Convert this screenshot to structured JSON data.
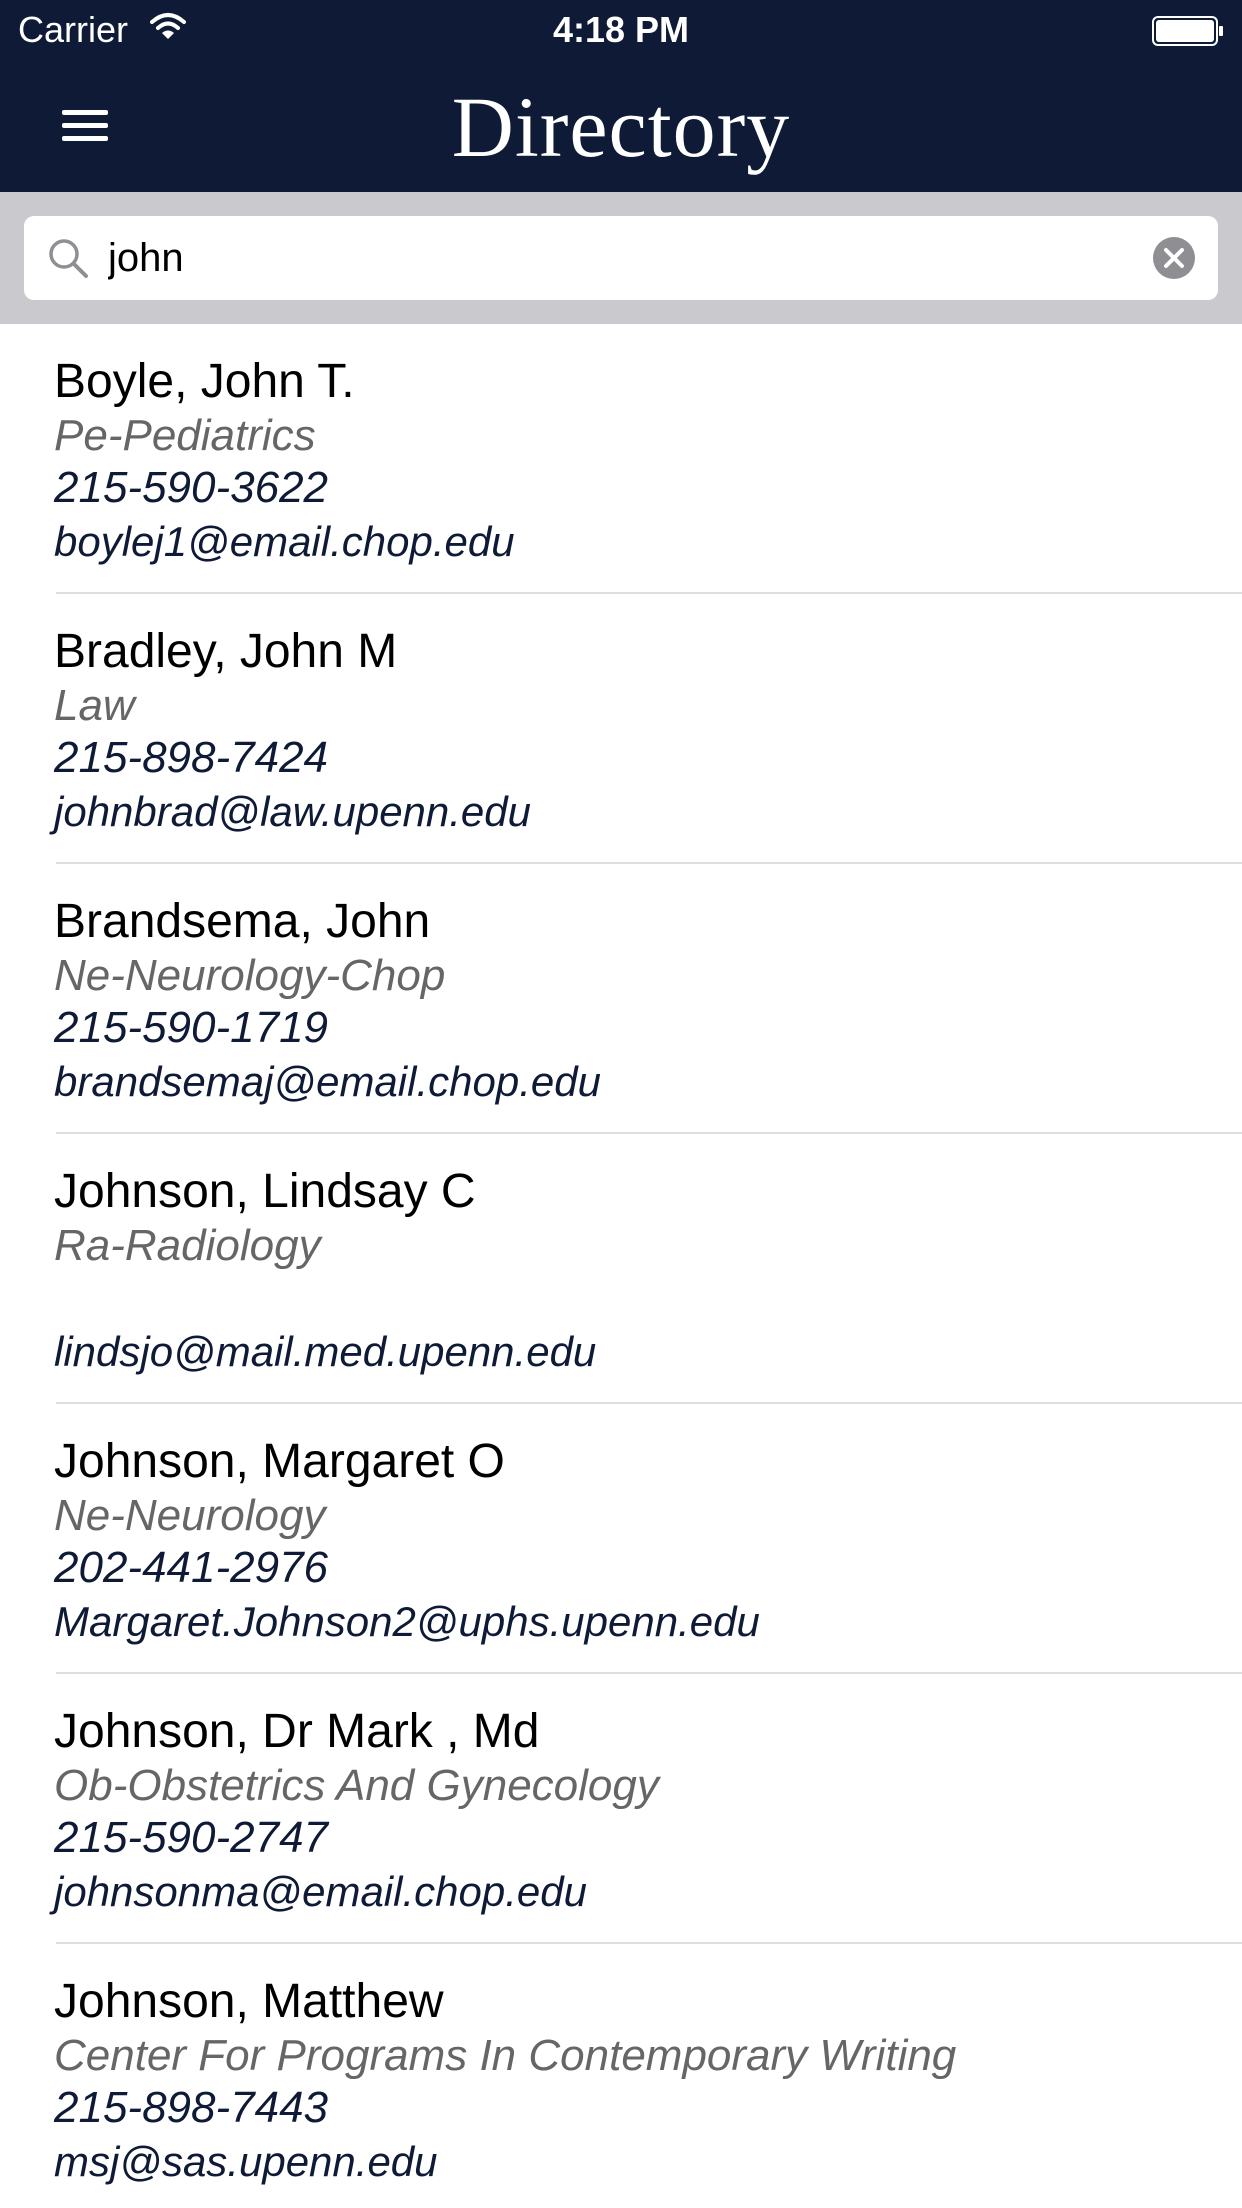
{
  "status_bar": {
    "carrier": "Carrier",
    "time": "4:18 PM"
  },
  "nav": {
    "title": "Directory",
    "menu_icon": "hamburger-menu-icon"
  },
  "search": {
    "value": "john",
    "placeholder": "Search",
    "search_icon": "search-icon",
    "clear_icon": "clear-icon"
  },
  "colors": {
    "nav_background": "#0e1a36",
    "search_bar_background": "#c9c9ce",
    "department_text": "#666666",
    "contact_text": "#0e1a36"
  },
  "results": [
    {
      "name": "Boyle, John T.",
      "department": "Pe-Pediatrics",
      "phone": "215-590-3622",
      "email": "boylej1@email.chop.edu"
    },
    {
      "name": "Bradley, John M",
      "department": "Law",
      "phone": "215-898-7424",
      "email": "johnbrad@law.upenn.edu"
    },
    {
      "name": "Brandsema, John",
      "department": "Ne-Neurology-Chop",
      "phone": "215-590-1719",
      "email": "brandsemaj@email.chop.edu"
    },
    {
      "name": "Johnson, Lindsay C",
      "department": "Ra-Radiology",
      "phone": "",
      "email": "lindsjo@mail.med.upenn.edu"
    },
    {
      "name": "Johnson, Margaret O",
      "department": "Ne-Neurology",
      "phone": "202-441-2976",
      "email": "Margaret.Johnson2@uphs.upenn.edu"
    },
    {
      "name": "Johnson, Dr Mark , Md",
      "department": "Ob-Obstetrics And Gynecology",
      "phone": "215-590-2747",
      "email": "johnsonma@email.chop.edu"
    },
    {
      "name": "Johnson, Matthew",
      "department": "Center For Programs In Contemporary Writing",
      "phone": "215-898-7443",
      "email": "msj@sas.upenn.edu"
    }
  ]
}
